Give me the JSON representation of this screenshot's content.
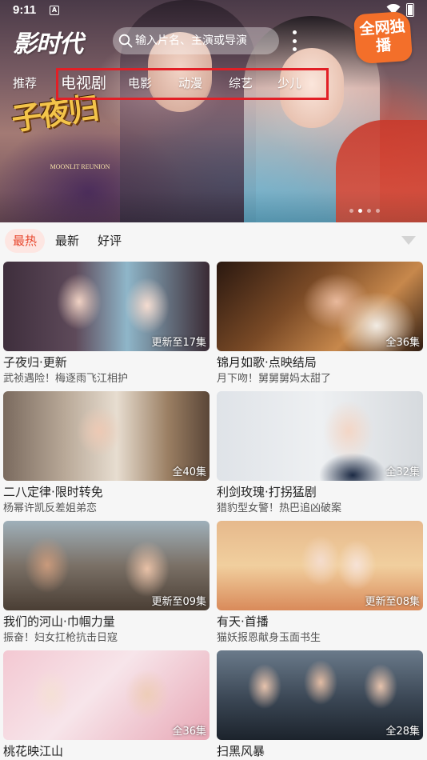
{
  "status_bar": {
    "time": "9:11",
    "app_icon_letter": "A"
  },
  "header": {
    "app_name": "影时代",
    "search_placeholder": "输入片名、主演或导演",
    "exclusive_badge": "全网独播"
  },
  "banner": {
    "drama_title_art": "子夜归",
    "drama_title_english": "MOONLIT REUNION",
    "active_dot_index": 1,
    "dot_count": 4
  },
  "category_tabs": [
    {
      "label": "推荐",
      "active": false
    },
    {
      "label": "电视剧",
      "active": true
    },
    {
      "label": "电影",
      "active": false
    },
    {
      "label": "动漫",
      "active": false
    },
    {
      "label": "综艺",
      "active": false
    },
    {
      "label": "少儿",
      "active": false
    }
  ],
  "sort_options": [
    {
      "label": "最热",
      "active": true
    },
    {
      "label": "最新",
      "active": false
    },
    {
      "label": "好评",
      "active": false
    }
  ],
  "items": [
    {
      "title": "子夜归·更新",
      "subtitle": "武祯遇险！梅逐雨飞江相护",
      "badge": "更新至17集"
    },
    {
      "title": "锦月如歌·点映结局",
      "subtitle": "月下吻！舅舅舅妈太甜了",
      "badge": "全36集"
    },
    {
      "title": "二八定律·限时转免",
      "subtitle": "杨幂许凯反差姐弟恋",
      "badge": "全40集"
    },
    {
      "title": "利剑玫瑰·打拐猛剧",
      "subtitle": "猎豹型女警！热巴追凶破案",
      "badge": "全32集"
    },
    {
      "title": "我们的河山·巾帼力量",
      "subtitle": "振奋！妇女扛枪抗击日寇",
      "badge": "更新至09集"
    },
    {
      "title": "有天·首播",
      "subtitle": "猫妖报恩献身玉面书生",
      "badge": "更新至08集"
    },
    {
      "title": "桃花映江山",
      "subtitle": "",
      "badge": "全36集"
    },
    {
      "title": "扫黑风暴",
      "subtitle": "",
      "badge": "全28集"
    }
  ],
  "colors": {
    "accent_red": "#e8482f",
    "highlight_box": "#e21f26",
    "badge_orange": "#f36f2a"
  }
}
